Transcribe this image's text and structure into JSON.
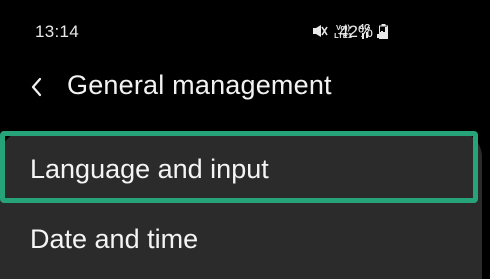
{
  "status_bar": {
    "time": "13:14",
    "network_voice_label": "Vo))",
    "network_lte_label": "LTE1",
    "network_4g_label": "4G",
    "battery_percent": "42%",
    "icons": [
      "mute-vibrate-icon",
      "volte-icon",
      "4g-data-icon",
      "signal-icon",
      "battery-icon"
    ]
  },
  "header": {
    "title": "General management",
    "back_icon": "chevron-left-icon"
  },
  "settings": {
    "items": [
      {
        "label": "Language and input",
        "highlighted": true
      },
      {
        "label": "Date and time",
        "highlighted": false
      }
    ]
  },
  "colors": {
    "background": "#000000",
    "card": "#2b2b2b",
    "highlight": "#27a37a",
    "text": "#f4f4f4"
  }
}
